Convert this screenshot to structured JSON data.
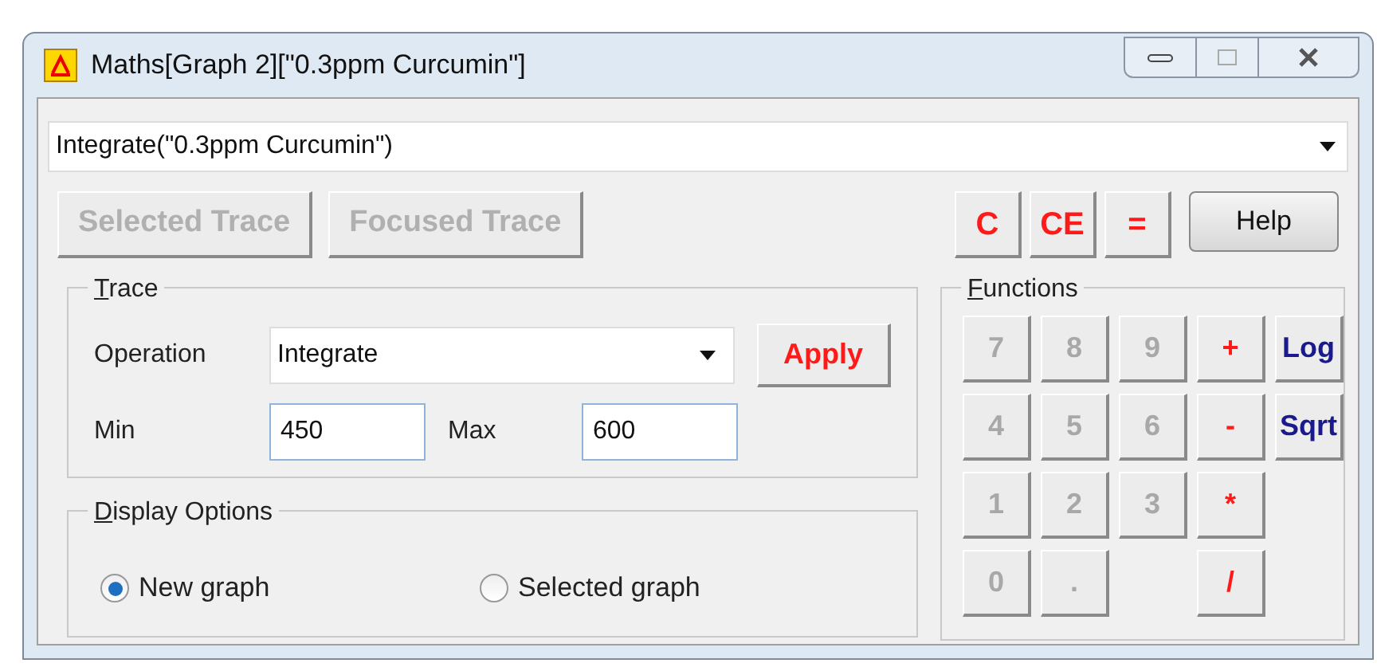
{
  "window": {
    "title": "Maths[Graph 2][\"0.3ppm Curcumin\"]"
  },
  "expression": {
    "value": "Integrate(\"0.3ppm Curcumin\")"
  },
  "trace_buttons": [
    {
      "label": "Selected Trace",
      "disabled": true
    },
    {
      "label": "Focused Trace",
      "disabled": true
    }
  ],
  "calc_buttons": [
    {
      "label": "C",
      "kind": "operator"
    },
    {
      "label": "CE",
      "kind": "operator"
    },
    {
      "label": "=",
      "kind": "operator"
    }
  ],
  "help_button": {
    "label": "Help"
  },
  "trace": {
    "title": "Trace",
    "operation_label": "Operation",
    "operation": "Integrate",
    "apply": "Apply",
    "min_label": "Min",
    "min": "450",
    "max_label": "Max",
    "max": "600"
  },
  "display_options": {
    "title": "Display Options",
    "options": [
      {
        "label": "New graph",
        "selected": true
      },
      {
        "label": "Selected graph",
        "selected": false
      }
    ]
  },
  "functions": {
    "title": "Functions",
    "rows": [
      [
        {
          "label": "7",
          "kind": "digit"
        },
        {
          "label": "8",
          "kind": "digit"
        },
        {
          "label": "9",
          "kind": "digit"
        },
        {
          "label": "+",
          "kind": "operator"
        },
        {
          "label": "Log",
          "kind": "function"
        }
      ],
      [
        {
          "label": "4",
          "kind": "digit"
        },
        {
          "label": "5",
          "kind": "digit"
        },
        {
          "label": "6",
          "kind": "digit"
        },
        {
          "label": "-",
          "kind": "operator"
        },
        {
          "label": "Sqrt",
          "kind": "function"
        }
      ],
      [
        {
          "label": "1",
          "kind": "digit"
        },
        {
          "label": "2",
          "kind": "digit"
        },
        {
          "label": "3",
          "kind": "digit"
        },
        {
          "label": "*",
          "kind": "operator"
        },
        {
          "kind": "gap"
        }
      ],
      [
        {
          "label": "0",
          "kind": "digit"
        },
        {
          "label": ".",
          "kind": "digit"
        },
        {
          "kind": "gap"
        },
        {
          "label": "/",
          "kind": "operator"
        },
        {
          "kind": "gap"
        }
      ]
    ]
  }
}
